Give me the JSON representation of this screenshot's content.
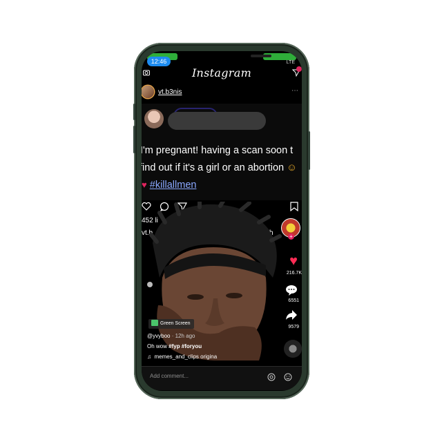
{
  "status_bar": {
    "time": "12:46",
    "network": "LTE"
  },
  "ig": {
    "logo": "Instagram"
  },
  "post": {
    "username": "vt.b3nis",
    "more_icon": "ellipsis-icon",
    "tweet_lines": [
      "I'm pregnant! having a scan soon t",
      "find out if it's a girl or an abortion"
    ],
    "hashtag": "#killallmen",
    "likes_fragment": "452 li",
    "caption_fragment": "vt.b",
    "caption_fragment2": "sh"
  },
  "tiktok": {
    "likes": "216.7K",
    "comments": "6551",
    "shares": "9579",
    "green_screen_label": "Green Screen",
    "username": "@yvyboo",
    "time_ago": "· 12h ago",
    "caption_prefix": "Oh wow ",
    "caption_tags": "#fyp #foryou",
    "sound": "memes_and_clips   origina"
  },
  "comment_bar": {
    "placeholder": "Add comment..."
  },
  "colors": {
    "accent_red": "#fe2c55",
    "hashtag_blue": "#8aa8ff",
    "frame": "#2a3a2e"
  }
}
